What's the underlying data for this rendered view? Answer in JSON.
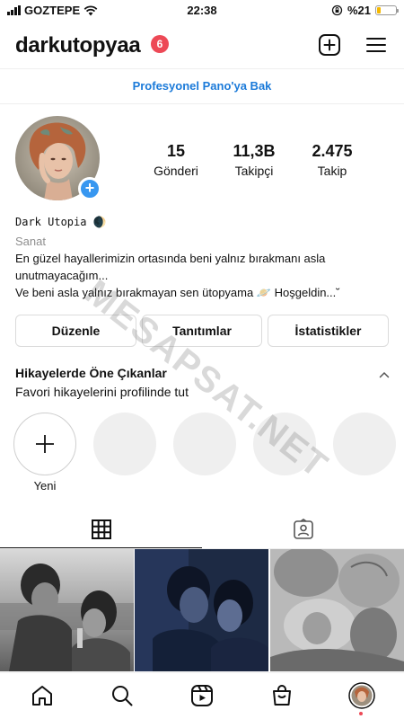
{
  "status_bar": {
    "carrier": "GOZTEPE",
    "time": "22:38",
    "battery_text": "%21",
    "battery_level": 0.21,
    "battery_color": "#f5b800"
  },
  "header": {
    "username": "darkutopyaa",
    "notification_count": "6",
    "icons": [
      "plus-square-icon",
      "menu-icon"
    ]
  },
  "dashboard_link": "Profesyonel Pano'ya Bak",
  "stats": {
    "posts": {
      "value": "15",
      "label": "Gönderi"
    },
    "followers": {
      "value": "11,3B",
      "label": "Takipçi"
    },
    "following": {
      "value": "2.475",
      "label": "Takip"
    }
  },
  "profile": {
    "display_name": "𝙳𝚊𝚛𝚔 𝚄𝚝𝚘𝚙𝚒𝚊 🌒",
    "category": "Sanat",
    "bio_line1": "En güzel hayallerimizin ortasında beni yalnız bırakmanı asla",
    "bio_line2": "unutmayacağım...",
    "bio_line3": "Ve beni asla yalnız bırakmayan sen ütopyama 🪐 Hoşgeldin...˘"
  },
  "buttons": {
    "edit": "Düzenle",
    "promotions": "Tanıtımlar",
    "insights": "İstatistikler"
  },
  "highlights": {
    "title": "Hikayelerde Öne Çıkanlar",
    "subtitle": "Favori hikayelerini profilinde tut",
    "new_label": "Yeni"
  },
  "watermark": "MESAPSAT.NET",
  "tabs": [
    "grid-icon",
    "tagged-icon"
  ],
  "bottom_nav": [
    "home-icon",
    "search-icon",
    "reels-icon",
    "shop-icon",
    "profile-avatar"
  ],
  "colors": {
    "accent_blue": "#1b7ad9",
    "badge_red": "#ed4956",
    "add_blue": "#3897f0"
  }
}
